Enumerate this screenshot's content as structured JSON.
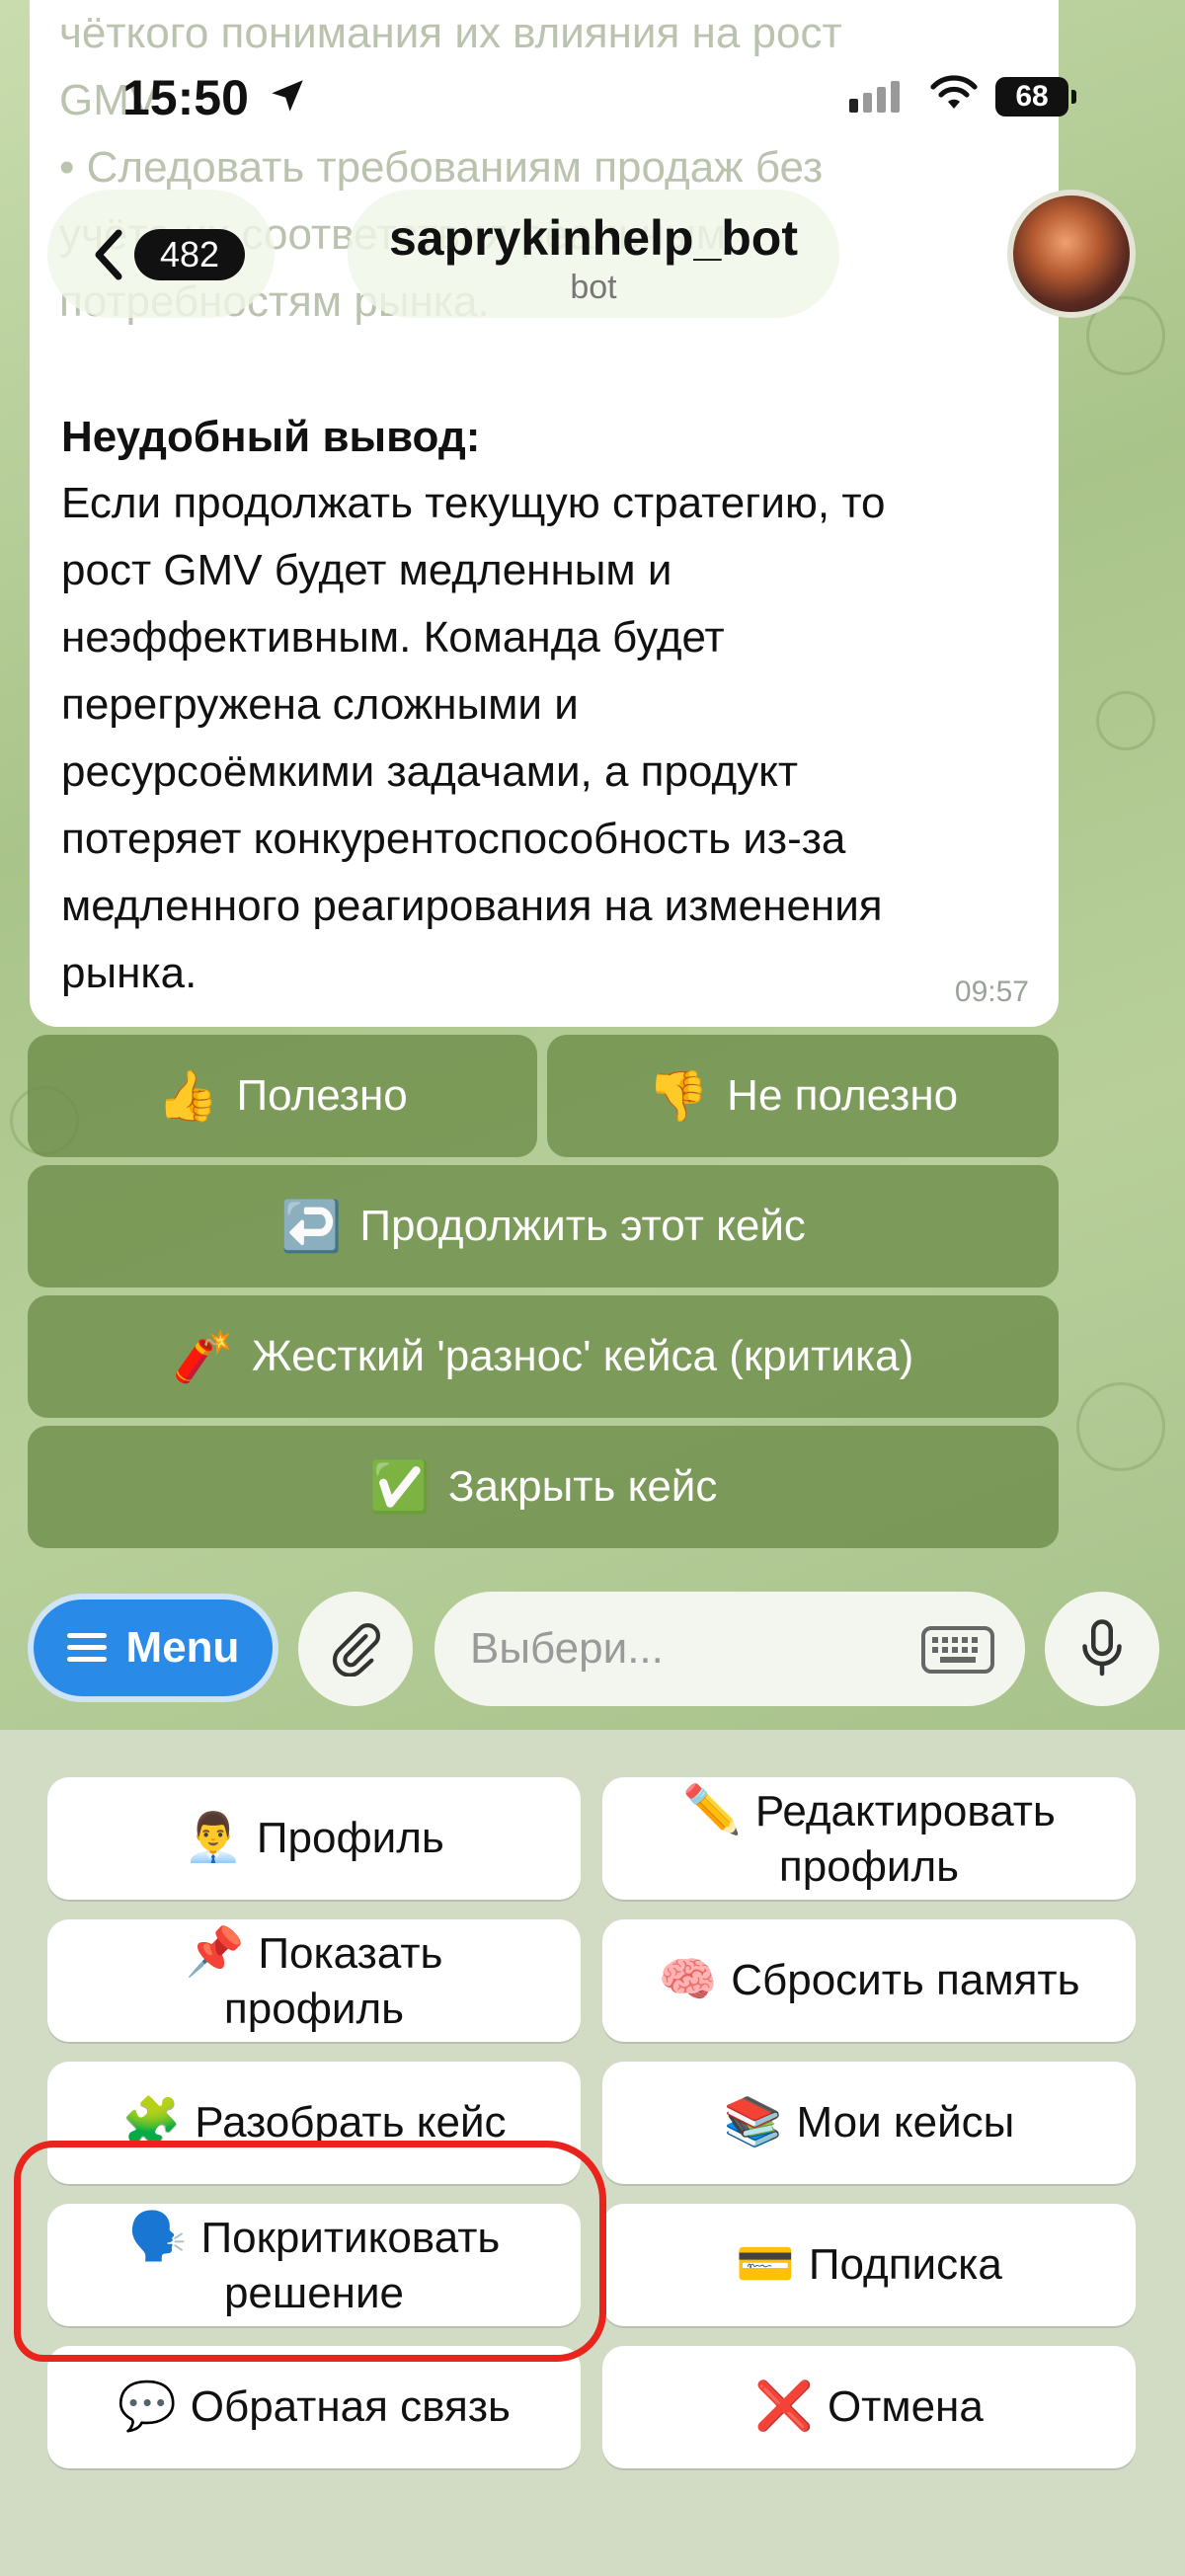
{
  "status_bar": {
    "time": "15:50",
    "battery": "68"
  },
  "header": {
    "back_count": "482",
    "title": "saprykinhelp_bot",
    "subtitle": "bot"
  },
  "message": {
    "faded_lines": [
      "чёткого понимания их влияния на рост",
      "GMV.",
      "• Следовать требованиям продаж без",
      "     учёта их соответствия реальным",
      "потребностям рынка."
    ],
    "conclusion_title": "Неудобный вывод:",
    "conclusion_lines": [
      "Если продолжать текущую стратегию, то",
      "рост GMV будет медленным и",
      "неэффективным. Команда будет",
      "перегружена сложными и",
      "ресурсоёмкими задачами, а продукт",
      "потеряет конкурентоспособность из-за",
      "медленного реагирования на изменения",
      "рынка."
    ],
    "time": "09:57"
  },
  "inline_keyboard": {
    "useful": {
      "emoji": "👍",
      "label": "Полезно"
    },
    "not_useful": {
      "emoji": "👎",
      "label": "Не полезно"
    },
    "continue": {
      "emoji": "↩️",
      "label": "Продолжить этот кейс"
    },
    "critique": {
      "emoji": "🧨",
      "label": "Жесткий 'разнос' кейса (критика)"
    },
    "close": {
      "emoji": "✅",
      "label": "Закрыть кейс"
    }
  },
  "input_bar": {
    "menu_label": "Menu",
    "placeholder": "Выбери..."
  },
  "reply_keyboard": {
    "profile": {
      "emoji": "👨‍💼",
      "label": "Профиль"
    },
    "edit_profile": {
      "emoji": "✏️",
      "line1": "Редактировать",
      "line2": "профиль"
    },
    "show_profile": {
      "emoji": "📌",
      "line1": "Показать",
      "line2": "профиль"
    },
    "reset_memory": {
      "emoji": "🧠",
      "label": "Сбросить память"
    },
    "analyze_case": {
      "emoji": "🧩",
      "label": "Разобрать кейс"
    },
    "my_cases": {
      "emoji": "📚",
      "label": "Мои кейсы"
    },
    "criticize": {
      "emoji": "🗣️",
      "line1": "Покритиковать",
      "line2": "решение"
    },
    "subscription": {
      "emoji": "💳",
      "label": "Подписка"
    },
    "feedback": {
      "emoji": "💬",
      "label": "Обратная связь"
    },
    "cancel": {
      "emoji": "❌",
      "label": "Отмена"
    }
  },
  "colors": {
    "accent_blue": "#2a8ae8",
    "inline_button": "#6c8c48",
    "annotation_red": "#e8241c"
  }
}
